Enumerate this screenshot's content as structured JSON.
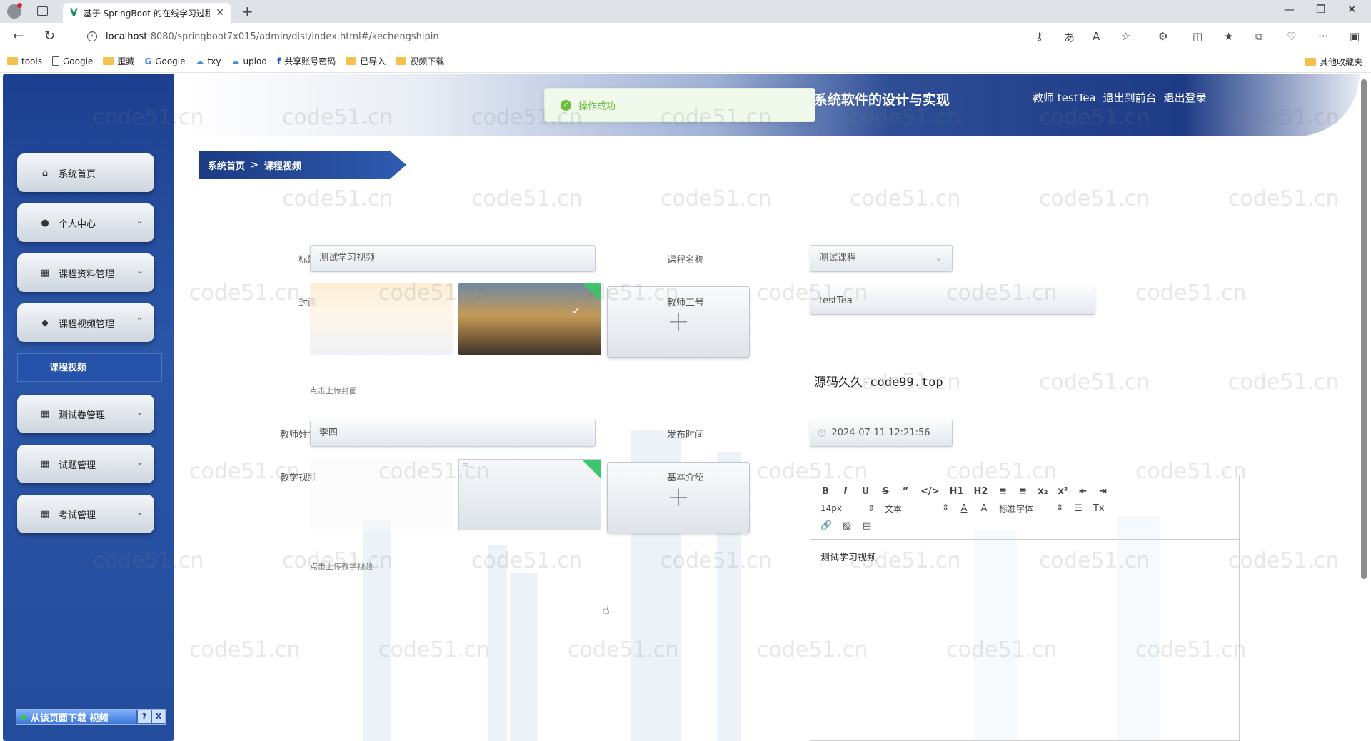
{
  "browser": {
    "tab_title": "基于 SpringBoot 的在线学习过程",
    "url_host": "localhost",
    "url_path": ":8080/springboot7x015/admin/dist/index.html#/kechengshipin",
    "bookmarks": [
      "tools",
      "Google",
      "歪藏",
      "Google",
      "txy",
      "uplod",
      "共享账号密码",
      "已导入",
      "视频下载"
    ],
    "other_bookmarks": "其他收藏夹"
  },
  "header": {
    "app_title": "系统软件的设计与实现",
    "user": "教师 testTea",
    "back_front": "退出到前台",
    "logout": "退出登录"
  },
  "toast": {
    "message": "操作成功"
  },
  "breadcrumb": {
    "home": "系统首页",
    "separator": ">",
    "current": "课程视频"
  },
  "sidebar": {
    "items": [
      {
        "label": "系统首页",
        "icon": "home-icon"
      },
      {
        "label": "个人中心",
        "icon": "user-icon"
      },
      {
        "label": "课程资料管理",
        "icon": "grid-icon"
      },
      {
        "label": "课程视频管理",
        "icon": "pin-icon"
      },
      {
        "label": "测试卷管理",
        "icon": "grid-icon"
      },
      {
        "label": "试题管理",
        "icon": "grid-icon"
      },
      {
        "label": "考试管理",
        "icon": "grid-icon"
      }
    ],
    "sub_active": "课程视频"
  },
  "download_bar": {
    "label": "从该页面下载 视频",
    "help": "?",
    "close": "X"
  },
  "form": {
    "title_label": "标题",
    "title_value": "测试学习视频",
    "course_label": "课程名称",
    "course_value": "测试课程",
    "cover_label": "封面",
    "cover_hint": "点击上传封面",
    "teacher_no_label": "教师工号",
    "teacher_no_value": "testTea",
    "teacher_name_label": "教师姓名",
    "teacher_name_value": "李四",
    "publish_label": "发布时间",
    "publish_value": "2024-07-11 12:21:56",
    "video_label": "教学视频",
    "video_hint": "点击上传教学视频",
    "intro_label": "基本介绍",
    "intro_value": "测试学习视频",
    "upload_plus": "+"
  },
  "editor": {
    "row1": [
      "B",
      "I",
      "U",
      "S",
      "”",
      "</>",
      "H1",
      "H2",
      "≡",
      "≡",
      "x₂",
      "x²",
      "⇤",
      "⇥"
    ],
    "font_size": "14px",
    "block_type": "文本",
    "font_family": "标准字体",
    "color_btn": "A",
    "bg_btn": "A",
    "clear_btn": "Tx"
  },
  "overlay_text": "源码久久-code99.top",
  "watermark": "code51.cn"
}
